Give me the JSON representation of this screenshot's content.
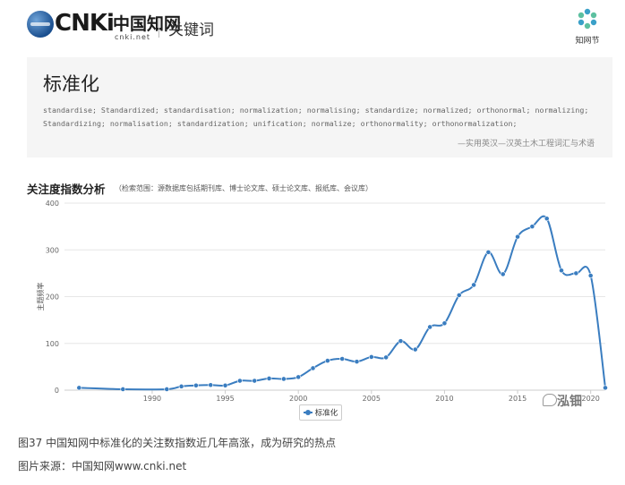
{
  "header": {
    "logo_text": "CNKi",
    "logo_cn": "中国知网",
    "logo_url": "cnki.net",
    "title": "关键词",
    "brand_text": "知网节"
  },
  "definition": {
    "term": "标准化",
    "translations": "standardise; Standardized; standardisation; normalization; normalising; standardize; normalized; orthonormal; normalizing; Standardizing; normalisation; standardization; unification; normalize; orthonormality; orthonormalization;",
    "source": "—实用英汉—汉英土木工程词汇与术语"
  },
  "analysis": {
    "title": "关注度指数分析",
    "subtitle": "（检索范围：源数据库包括期刊库、博士论文库、硕士论文库、报纸库、会议库）"
  },
  "chart_data": {
    "type": "line",
    "ylabel": "主题频率",
    "xlabel": "",
    "ylim": [
      0,
      400
    ],
    "xlim": [
      1984,
      2021
    ],
    "yticks": [
      0,
      100,
      200,
      300,
      400
    ],
    "xticks": [
      1990,
      1995,
      2000,
      2005,
      2010,
      2015,
      2020
    ],
    "xtick_labels": [
      "1990",
      "1995",
      "2000",
      "2005",
      "2010",
      "2015",
      "2020"
    ],
    "grid": "horizontal",
    "legend": "bottom-center",
    "colors": {
      "series": "#3a7dc0",
      "grid": "#e6e6e6",
      "axis": "#cccccc"
    },
    "series": [
      {
        "name": "标准化",
        "x": [
          1985,
          1988,
          1991,
          1992,
          1993,
          1994,
          1995,
          1996,
          1997,
          1998,
          1999,
          2000,
          2001,
          2002,
          2003,
          2004,
          2005,
          2006,
          2007,
          2008,
          2009,
          2010,
          2011,
          2012,
          2013,
          2014,
          2015,
          2016,
          2017,
          2018,
          2019,
          2020,
          2021
        ],
        "y": [
          5,
          2,
          2,
          8,
          10,
          11,
          10,
          20,
          20,
          25,
          24,
          28,
          47,
          63,
          67,
          61,
          71,
          70,
          105,
          87,
          135,
          143,
          203,
          225,
          295,
          248,
          328,
          350,
          367,
          256,
          250,
          245,
          5
        ]
      }
    ]
  },
  "watermark": "泓钿",
  "caption": "图37 中国知网中标准化的关注数指数近几年高涨，成为研究的热点",
  "source_line": "图片来源：中国知网www.cnki.net"
}
